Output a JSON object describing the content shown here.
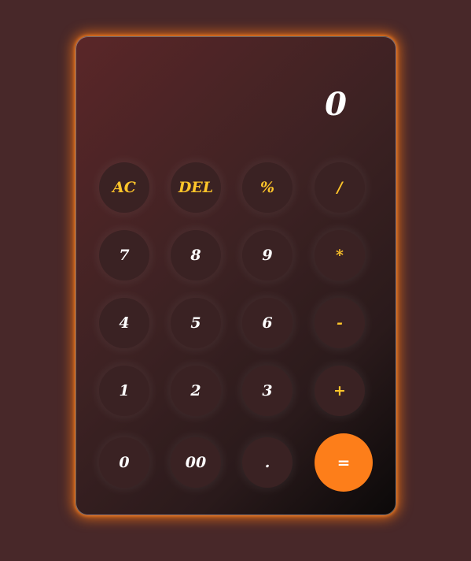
{
  "display": {
    "value": "0"
  },
  "keys": {
    "ac": "AC",
    "del": "DEL",
    "percent": "%",
    "divide": "/",
    "seven": "7",
    "eight": "8",
    "nine": "9",
    "multiply": "*",
    "four": "4",
    "five": "5",
    "six": "6",
    "subtract": "-",
    "one": "1",
    "two": "2",
    "three": "3",
    "add": "+",
    "zero": "0",
    "double_zero": "00",
    "decimal": ".",
    "equals": "="
  },
  "colors": {
    "accent": "#fd7e1a",
    "function_text": "#ffc52a",
    "number_text": "#ffffff",
    "page_background": "#482829"
  }
}
